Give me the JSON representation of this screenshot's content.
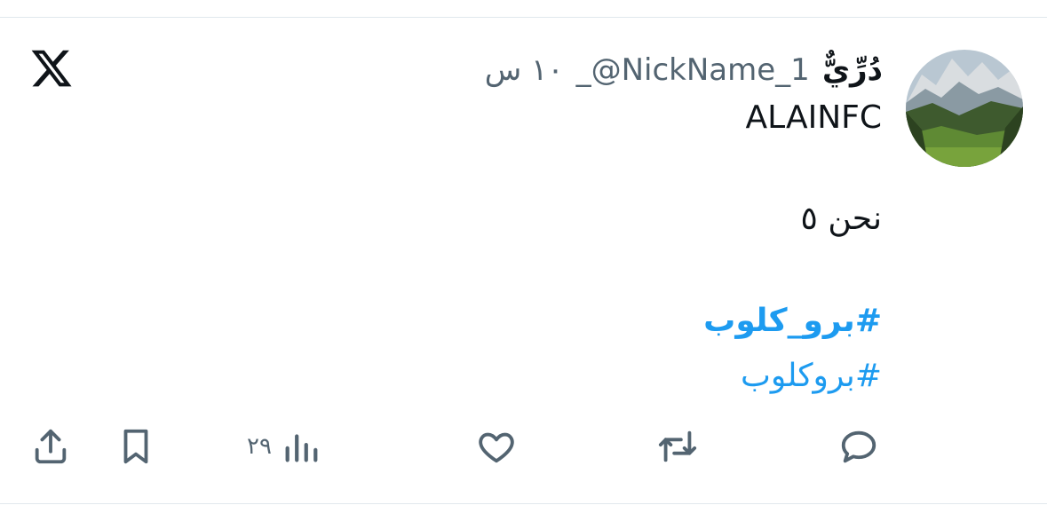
{
  "tweet": {
    "author": {
      "display_name": "دُرِّيٌّ",
      "handle": "_@NickName_1",
      "timestamp": "١٠ س"
    },
    "text_line_1": "ALAINFC",
    "text_line_2": "نحن ٥",
    "hashtags": [
      "#برو_كلوب",
      "#بروكلوب"
    ],
    "actions": {
      "reply_icon": "speech-bubble-icon",
      "retweet_icon": "retweet-arrows-icon",
      "like_icon": "heart-icon",
      "views_icon": "bar-chart-icon",
      "views_count": "٢٩",
      "bookmark_icon": "bookmark-icon",
      "share_icon": "share-upload-icon"
    }
  },
  "brand": {
    "logo_icon": "x-logo-icon",
    "color": "#0f1419"
  },
  "colors": {
    "hashtag": "#1d9bf0",
    "secondary_text": "#536471",
    "divider": "#e1e8ed"
  }
}
